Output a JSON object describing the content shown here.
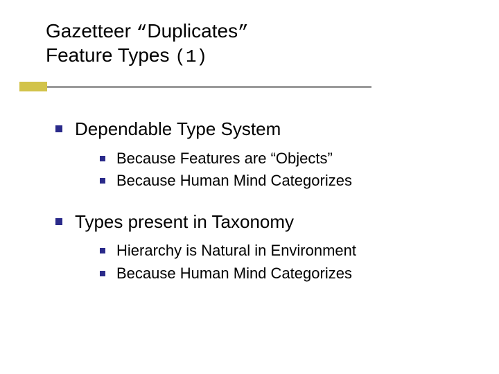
{
  "title": {
    "line1_a": "Gazetteer ",
    "line1_b": "“",
    "line1_c": "Duplicates",
    "line1_d": "”",
    "line2_a": "Feature Types ",
    "line2_b": "(1)"
  },
  "points": {
    "p1": "Dependable Type System",
    "p1_sub": {
      "a": "Because Features are “Objects”",
      "b": "Because Human Mind Categorizes"
    },
    "p2": "Types present in Taxonomy",
    "p2_sub": {
      "a": "Hierarchy is Natural in Environment",
      "b": "Because Human Mind Categorizes"
    }
  }
}
